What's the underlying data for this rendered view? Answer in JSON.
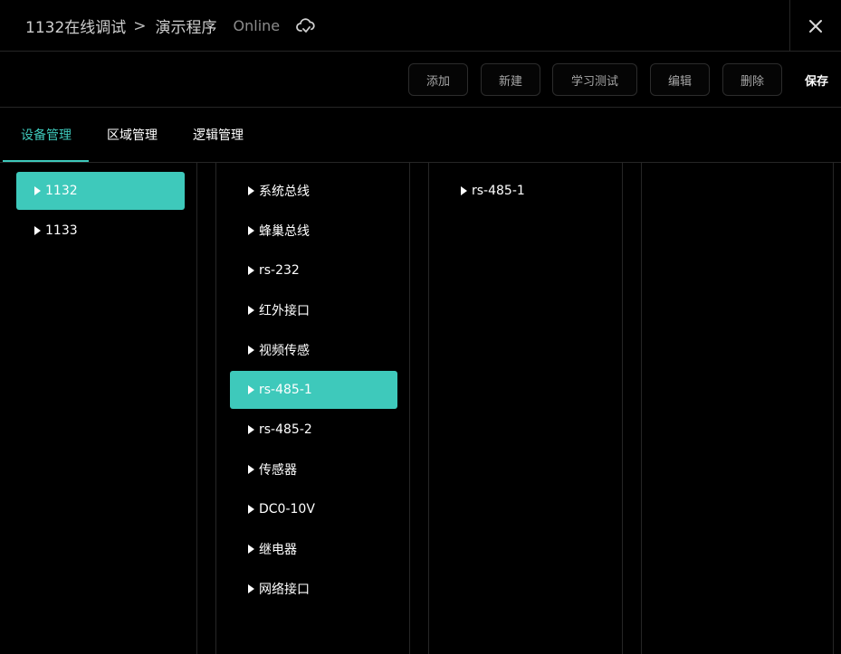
{
  "header": {
    "project": "1132在线调试",
    "separator": ">",
    "program": "演示程序",
    "status": "Online",
    "cloud_icon": "cloud-sync-icon",
    "close_icon": "close-icon"
  },
  "toolbar": {
    "buttons": [
      "添加",
      "新建",
      "学习测试",
      "编辑",
      "删除"
    ],
    "save_label": "保存"
  },
  "tabs": [
    "设备管理",
    "区域管理",
    "逻辑管理"
  ],
  "active_tab": 0,
  "colors": {
    "accent": "#3ec9bb",
    "background": "#000000",
    "border": "#262626"
  },
  "devices": {
    "items": [
      "1132",
      "1133"
    ],
    "selected": 0
  },
  "interfaces": {
    "items": [
      "系统总线",
      "蜂巢总线",
      "rs-232",
      "红外接口",
      "视频传感",
      "rs-485-1",
      "rs-485-2",
      "传感器",
      "DC0-10V",
      "继电器",
      "网络接口"
    ],
    "selected": 5
  },
  "channels": {
    "items": [
      "rs-485-1"
    ]
  }
}
